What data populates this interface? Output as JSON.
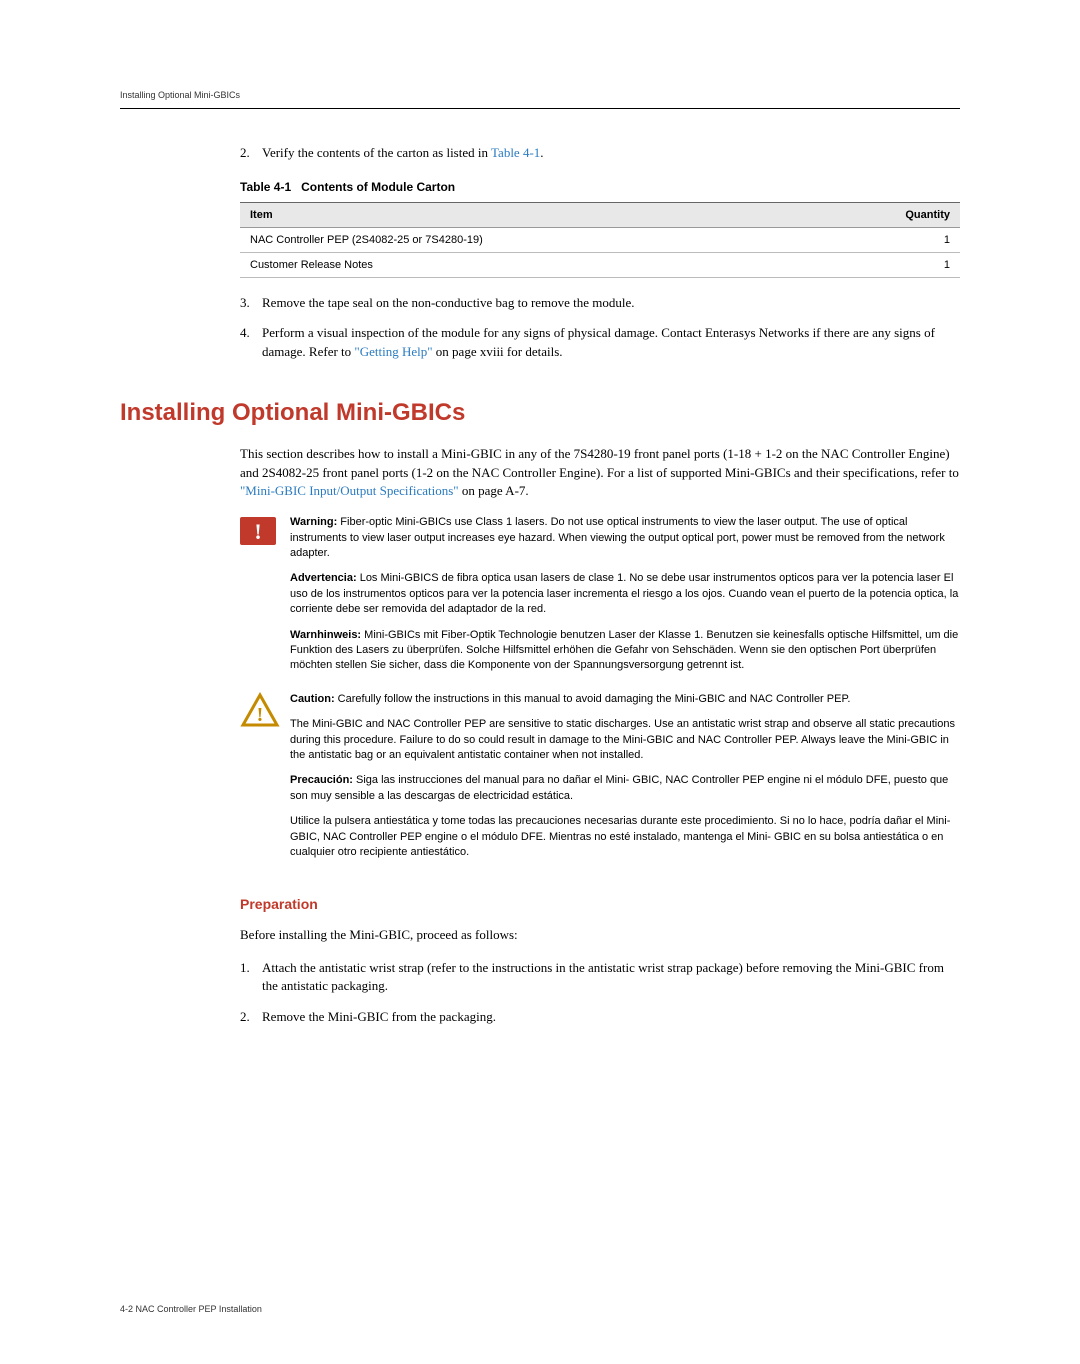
{
  "header": "Installing Optional Mini-GBICs",
  "step2": {
    "num": "2.",
    "text_a": "Verify the contents of the carton as listed in ",
    "link": "Table 4-1",
    "text_b": "."
  },
  "table": {
    "caption_num": "Table 4-1",
    "caption_title": "Contents of Module Carton",
    "headers": {
      "item": "Item",
      "qty": "Quantity"
    },
    "rows": [
      {
        "item": "NAC Controller PEP (2S4082-25 or 7S4280-19)",
        "qty": "1"
      },
      {
        "item": "Customer Release Notes",
        "qty": "1"
      }
    ]
  },
  "step3": {
    "num": "3.",
    "text": "Remove the tape seal on the non-conductive bag to remove the module."
  },
  "step4": {
    "num": "4.",
    "text_a": "Perform a visual inspection of the module for any signs of physical damage. Contact Enterasys Networks if there are any signs of damage. Refer to ",
    "link": "\"Getting Help\"",
    "text_b": " on page xviii for details."
  },
  "section_title": "Installing Optional Mini-GBICs",
  "intro": {
    "text_a": "This section describes how to install a Mini-GBIC in any of the 7S4280-19 front panel ports (1-18 + 1-2 on the NAC Controller Engine) and 2S4082-25 front panel ports (1-2 on the NAC Controller Engine). For a list of supported Mini-GBICs and their specifications, refer to ",
    "link": "\"Mini-GBIC Input/Output Specifications\"",
    "text_b": " on page A-7."
  },
  "warning": {
    "p1_label": "Warning:",
    "p1_text": " Fiber-optic Mini-GBICs use Class 1 lasers. Do not use optical instruments to view the laser output. The use of optical instruments to view laser output increases eye hazard. When viewing the output optical port, power must be removed from the network adapter.",
    "p2_label": "Advertencia:",
    "p2_text": " Los Mini-GBICS de fibra optica usan lasers de clase 1. No se debe usar instrumentos opticos para ver la potencia laser El uso de los instrumentos opticos para ver la potencia laser incrementa el riesgo a los ojos. Cuando vean el puerto de la potencia optica, la corriente debe ser removida del adaptador de la red.",
    "p3_label": "Warnhinweis:",
    "p3_text": " Mini-GBICs mit Fiber-Optik Technologie benutzen Laser der Klasse 1. Benutzen sie keinesfalls optische Hilfsmittel, um die Funktion des Lasers zu überprüfen. Solche Hilfsmittel erhöhen die Gefahr von Sehschäden. Wenn sie den optischen Port überprüfen möchten stellen Sie sicher, dass die Komponente von der Spannungsversorgung getrennt ist."
  },
  "caution": {
    "p1_label": "Caution:",
    "p1_text": " Carefully follow the instructions in this manual to avoid damaging the Mini-GBIC and NAC Controller PEP.",
    "p2_text": "The Mini-GBIC and NAC Controller PEP are sensitive to static discharges. Use an antistatic wrist strap and observe all static precautions during this procedure. Failure to do so could result in damage to the Mini-GBIC and NAC Controller PEP. Always leave the Mini-GBIC in the antistatic bag or an equivalent antistatic container when not installed.",
    "p3_label": "Precaución:",
    "p3_text": " Siga las instrucciones del manual para no dañar el Mini- GBIC, NAC Controller PEP engine ni el módulo DFE, puesto que son muy sensible a las descargas de electricidad estática.",
    "p4_text": "Utilice la pulsera antiestática y tome todas las precauciones necesarias durante este procedimiento. Si no lo hace, podría dañar el Mini- GBIC, NAC Controller PEP engine o el módulo DFE. Mientras no esté instalado, mantenga el Mini- GBIC en su bolsa antiestática o en cualquier otro recipiente antiestático."
  },
  "preparation": {
    "heading": "Preparation",
    "lead": "Before installing the Mini-GBIC, proceed as follows:",
    "s1_num": "1.",
    "s1_text": "Attach the antistatic wrist strap (refer to the instructions in the antistatic wrist strap package) before removing the Mini-GBIC from the antistatic packaging.",
    "s2_num": "2.",
    "s2_text": "Remove the Mini-GBIC from the packaging."
  },
  "footer": "4-2  NAC Controller PEP Installation"
}
